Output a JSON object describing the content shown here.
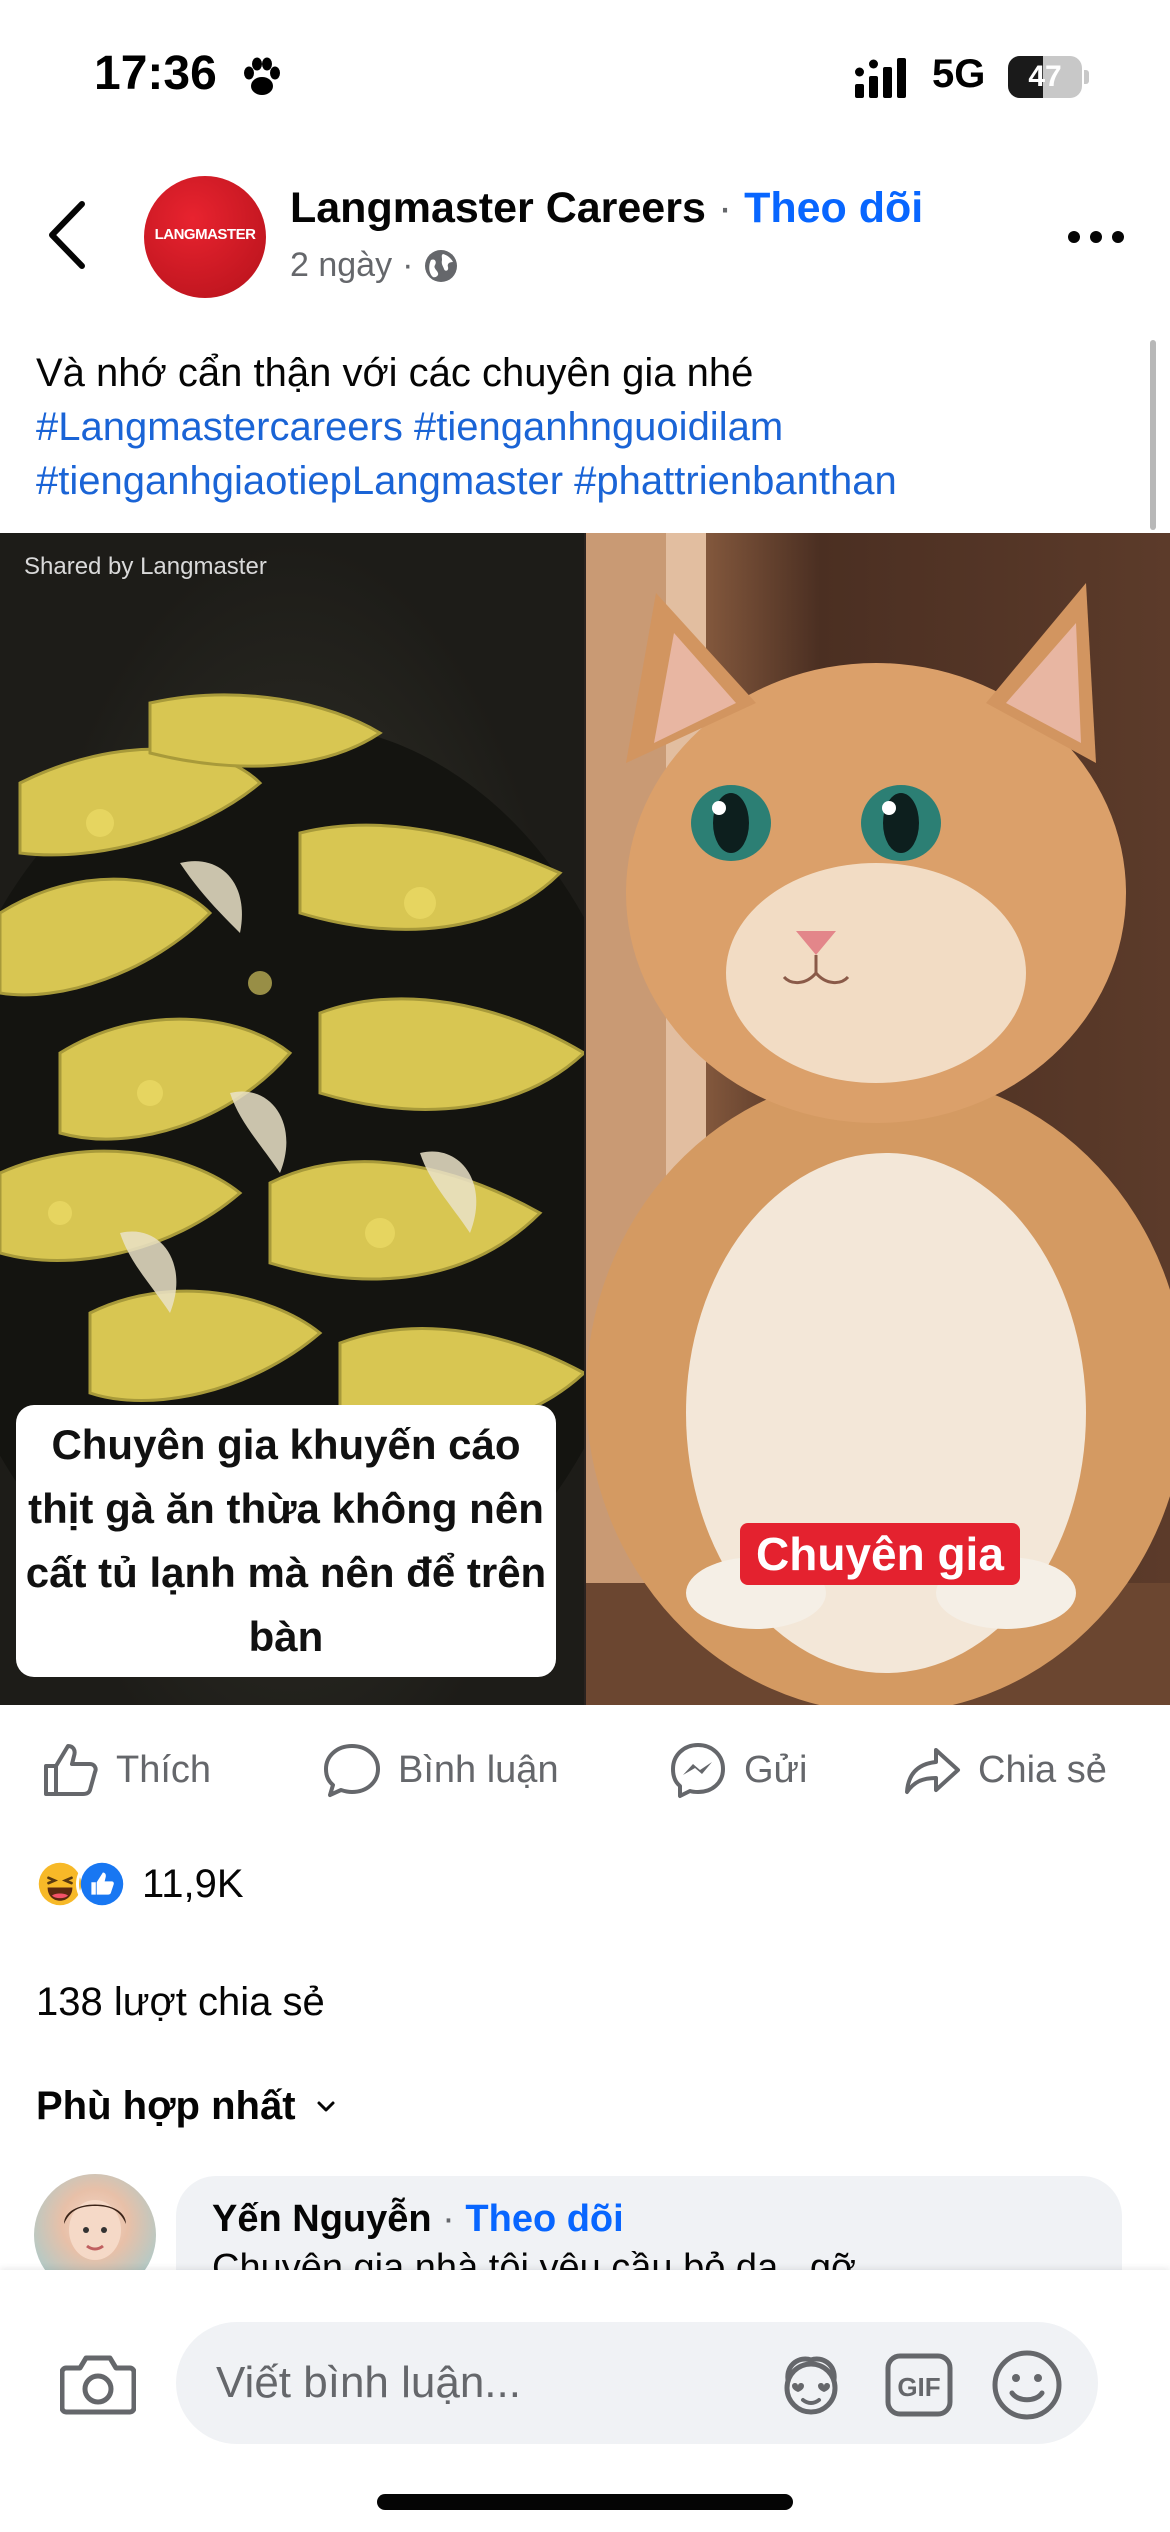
{
  "status_bar": {
    "time": "17:36",
    "network": "5G",
    "battery_level": "47",
    "battery_fraction": 0.47
  },
  "post": {
    "page_name": "Langmaster Careers",
    "separator": "·",
    "follow_label": "Theo dõi",
    "time_ago": "2 ngày",
    "meta_separator": "·",
    "avatar_text": "LANGMASTER",
    "caption_text": "Và nhớ cẩn thận với các chuyên gia nhé",
    "hashtags_line1": "#Langmastercareers #tienganhnguoidilam",
    "hashtags_line2": "#tienganhgiaotiepLangmaster #phattrienbanthan"
  },
  "image": {
    "watermark": "Shared by Langmaster",
    "left_caption": "Chuyên gia khuyến cáo thịt gà ăn thừa không nên cất tủ lạnh mà nên để trên bàn",
    "right_tag": "Chuyên gia"
  },
  "actions": {
    "like": "Thích",
    "comment": "Bình luận",
    "send": "Gửi",
    "share": "Chia sẻ"
  },
  "stats": {
    "reaction_count": "11,9K",
    "shares": "138 lượt chia sẻ"
  },
  "comments": {
    "sort_label": "Phù hợp nhất",
    "preview": {
      "author": "Yến Nguyễn",
      "separator": "·",
      "follow_label": "Theo dõi",
      "text": "Chuyên gia nhà tôi yêu cầu bỏ da...gỡ"
    }
  },
  "composer": {
    "placeholder": "Viết bình luận..."
  },
  "colors": {
    "accent_blue": "#0866ff",
    "hashtag_blue": "#1a64d6",
    "brand_red": "#d3161f",
    "meme_tag_red": "#e4222f",
    "secondary_text": "#65676b"
  },
  "icons": [
    "paw-icon",
    "signal-icon",
    "back-icon",
    "globe-icon",
    "more-icon",
    "like-icon",
    "comment-icon",
    "messenger-icon",
    "share-icon",
    "haha-reaction-icon",
    "like-reaction-icon",
    "chevron-down-icon",
    "camera-icon",
    "avatar-sticker-icon",
    "gif-icon",
    "emoji-icon"
  ]
}
